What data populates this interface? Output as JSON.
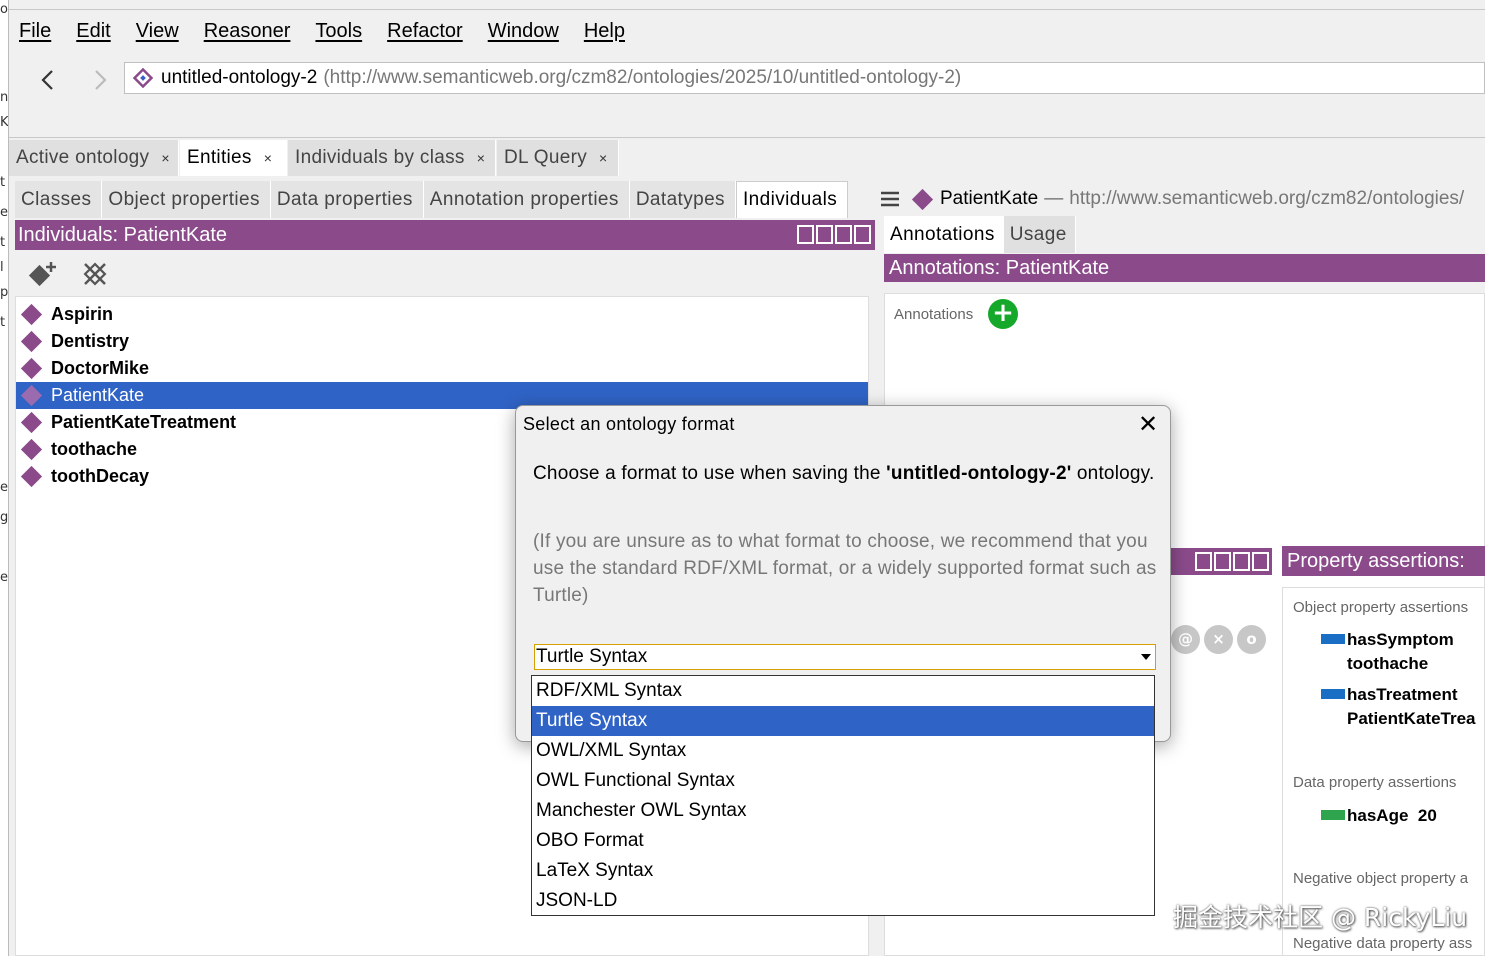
{
  "left_strip_chars": [
    "o",
    "n",
    "K",
    "t",
    "e",
    "t",
    "l",
    "p",
    "t",
    "e",
    "g",
    "e"
  ],
  "menu": [
    "File",
    "Edit",
    "View",
    "Reasoner",
    "Tools",
    "Refactor",
    "Window",
    "Help"
  ],
  "address": {
    "name": "untitled-ontology-2",
    "url": "(http://www.semanticweb.org/czm82/ontologies/2025/10/untitled-ontology-2)"
  },
  "tabs": [
    {
      "label": "Active ontology",
      "close": "×"
    },
    {
      "label": "Entities",
      "close": "×"
    },
    {
      "label": "Individuals by class",
      "close": "×"
    },
    {
      "label": "DL Query",
      "close": "×"
    }
  ],
  "subtabs": [
    "Classes",
    "Object properties",
    "Data properties",
    "Annotation properties",
    "Datatypes",
    "Individuals"
  ],
  "individuals": {
    "header": "Individuals: PatientKate",
    "items": [
      "Aspirin",
      "Dentistry",
      "DoctorMike",
      "PatientKate",
      "PatientKateTreatment",
      "toothache",
      "toothDecay"
    ],
    "selected_index": 3
  },
  "entity": {
    "name": "PatientKate",
    "separator": "—",
    "url": "http://www.semanticweb.org/czm82/ontologies/"
  },
  "annotation_tabs": [
    "Annotations",
    "Usage"
  ],
  "annotations": {
    "header": "Annotations: PatientKate",
    "label": "Annotations",
    "add": "+"
  },
  "circle_buttons": [
    "@",
    "×",
    "o"
  ],
  "property_assertions": {
    "header": "Property assertions:",
    "object_section": "Object property assertions",
    "items": [
      {
        "property": "hasSymptom",
        "value": "toothache",
        "color": "#1a6fc4"
      },
      {
        "property": "hasTreatment",
        "value": "PatientKateTrea",
        "color": "#1a6fc4"
      }
    ],
    "data_section": "Data property assertions",
    "data_items": [
      {
        "property": "hasAge",
        "value": "20",
        "color": "#2ea44f"
      }
    ],
    "neg_object_section": "Negative object property a",
    "neg_data_section": "Negative data property ass"
  },
  "dialog": {
    "title": "Select an ontology format",
    "close": "✕",
    "message_prefix": "Choose a format to use when saving the ",
    "message_name": "'untitled-ontology-2'",
    "message_suffix": " ontology.",
    "hint": "(If you are unsure as to what format to choose, we recommend that you use the standard RDF/XML format, or a widely supported format such as Turtle)",
    "selected_format": "Turtle Syntax"
  },
  "formats": [
    "RDF/XML Syntax",
    "Turtle Syntax",
    "OWL/XML Syntax",
    "OWL Functional Syntax",
    "Manchester OWL Syntax",
    "OBO Format",
    "LaTeX Syntax",
    "JSON-LD"
  ],
  "formats_selected_index": 1,
  "watermark": "掘金技术社区 @ RickyLiu",
  "colors": {
    "header_purple": "#8b4b8b",
    "selection_blue": "#2f63c5",
    "add_green": "#16a82b"
  }
}
